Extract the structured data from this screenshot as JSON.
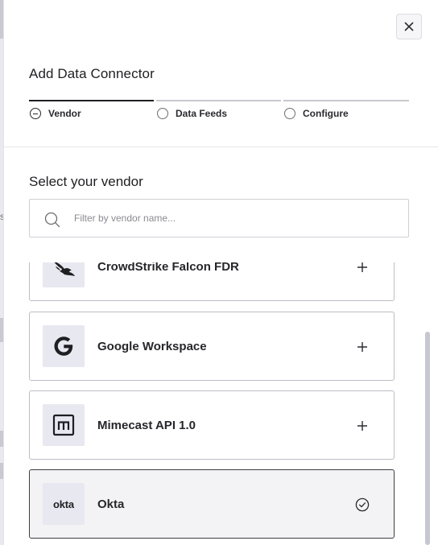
{
  "dialog": {
    "title": "Add Data Connector",
    "close_icon": "close-icon"
  },
  "steps": [
    {
      "label": "Vendor",
      "state": "active",
      "icon": "minus-circle-icon"
    },
    {
      "label": "Data Feeds",
      "state": "pending",
      "icon": "empty-circle-icon"
    },
    {
      "label": "Configure",
      "state": "pending",
      "icon": "empty-circle-icon"
    }
  ],
  "vendor_section": {
    "title": "Select your vendor",
    "search_placeholder": "Filter by vendor name...",
    "search_value": ""
  },
  "vendors": [
    {
      "name": "CrowdStrike Falcon FDR",
      "logo": "crowdstrike-falcon-logo",
      "action": "plus-icon",
      "selected": false
    },
    {
      "name": "Google Workspace",
      "logo": "google-g-logo",
      "action": "plus-icon",
      "selected": false
    },
    {
      "name": "Mimecast API 1.0",
      "logo": "mimecast-m-logo",
      "action": "plus-icon",
      "selected": false
    },
    {
      "name": "Okta",
      "logo": "okta-logo",
      "logo_text": "okta",
      "action": "check-circle-icon",
      "selected": true
    }
  ],
  "background": {
    "partial_letter": "s"
  },
  "colors": {
    "text": "#1f1f23",
    "logo_bg": "#e8e8f0",
    "selected_bg": "#f3f3f5",
    "border": "#bdbdc5"
  }
}
